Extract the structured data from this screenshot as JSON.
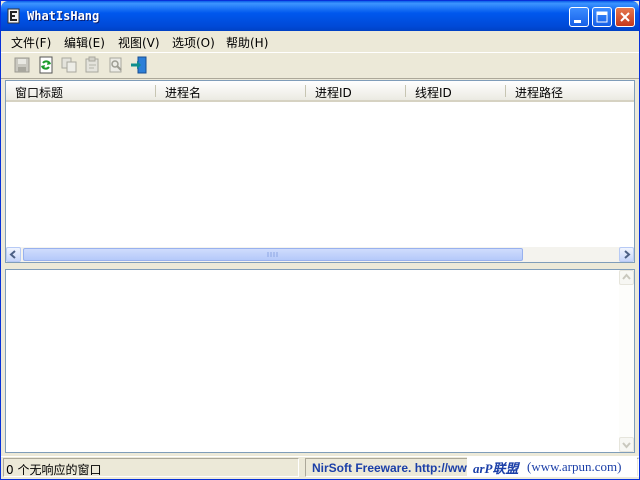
{
  "window": {
    "title": "WhatIsHang",
    "icon": "app-icon",
    "controls": [
      "minimize-icon",
      "maximize-icon",
      "close-icon"
    ]
  },
  "menu": [
    {
      "label": "文件(F)"
    },
    {
      "label": "编辑(E)"
    },
    {
      "label": "视图(V)"
    },
    {
      "label": "选项(O)"
    },
    {
      "label": "帮助(H)"
    }
  ],
  "toolbar": [
    "save-icon",
    "refresh-icon",
    "copy-icon",
    "properties-icon",
    "find-icon",
    "exit-icon"
  ],
  "list": {
    "columns": [
      "窗口标题",
      "进程名",
      "进程ID",
      "线程ID",
      "进程路径"
    ],
    "rows": []
  },
  "status": {
    "count_text": "0 个无响应的窗口",
    "credit": "NirSoft Freeware.  http://www",
    "watermark_logo": "arP联盟",
    "watermark_url": "(www.arpun.com)"
  },
  "colors": {
    "titlebar": "#0058EE",
    "face": "#ECE9D8",
    "credit_text": "#1B3FA8"
  }
}
